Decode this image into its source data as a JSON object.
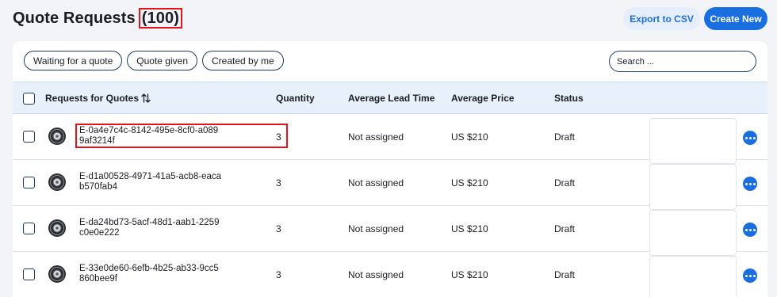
{
  "header": {
    "title": "Quote Requests",
    "count": "(100)",
    "export_label": "Export to CSV",
    "create_label": "Create New"
  },
  "filters": [
    {
      "label": "Waiting for a quote"
    },
    {
      "label": "Quote given"
    },
    {
      "label": "Created by me"
    }
  ],
  "search": {
    "placeholder": "Search ...",
    "value": ""
  },
  "table": {
    "columns": {
      "requests": "Requests for Quotes",
      "quantity": "Quantity",
      "lead_time": "Average Lead Time",
      "price": "Average Price",
      "status": "Status"
    },
    "rows": [
      {
        "id": "E-0a4e7c4c-8142-495e-8cf0-a0899af3214f",
        "quantity": "3",
        "lead_time": "Not assigned",
        "price": "US $210",
        "status": "Draft"
      },
      {
        "id": "E-d1a00528-4971-41a5-acb8-eacab570fab4",
        "quantity": "3",
        "lead_time": "Not assigned",
        "price": "US $210",
        "status": "Draft"
      },
      {
        "id": "E-da24bd73-5acf-48d1-aab1-2259c0e0e222",
        "quantity": "3",
        "lead_time": "Not assigned",
        "price": "US $210",
        "status": "Draft"
      },
      {
        "id": "E-33e0de60-6efb-4b25-ab33-9cc5860bee9f",
        "quantity": "3",
        "lead_time": "Not assigned",
        "price": "US $210",
        "status": "Draft"
      }
    ]
  },
  "icons": {
    "row_image": "tire-icon",
    "row_menu": "more-options-icon",
    "sort": "sort-arrows-icon"
  },
  "colors": {
    "accent": "#1a6fe0",
    "highlight": "#e4121b",
    "header_bg": "#e8f0fb"
  }
}
